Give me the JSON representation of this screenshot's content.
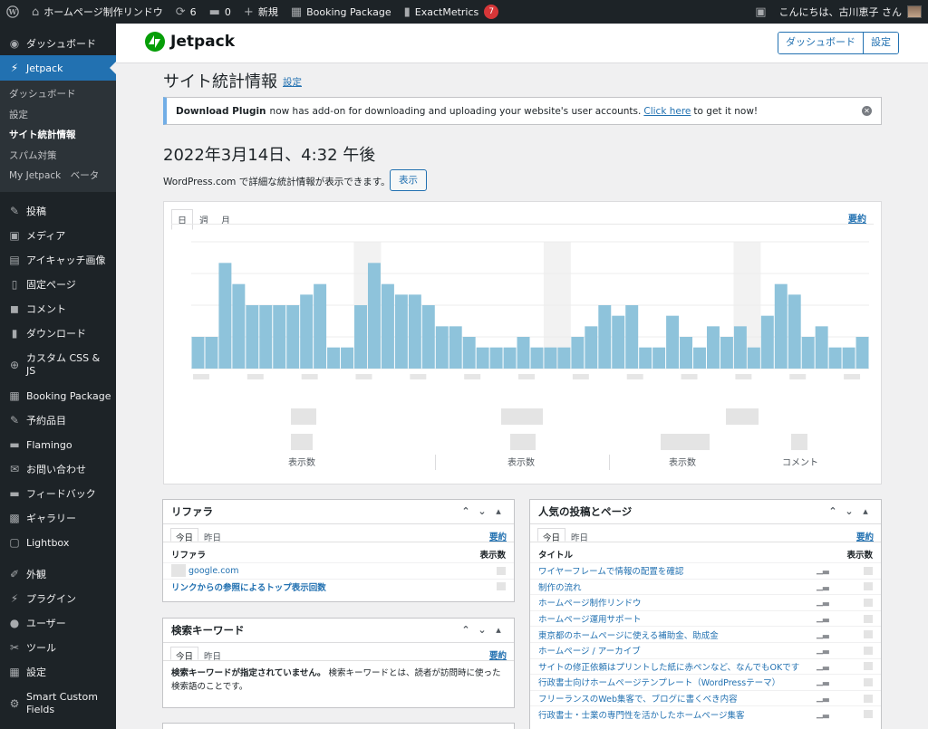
{
  "adminbar": {
    "site_name": "ホームページ制作リンドウ",
    "updates_count": "6",
    "comments_count": "0",
    "new_label": "新規",
    "booking_label": "Booking Package",
    "exactmetrics_label": "ExactMetrics",
    "exactmetrics_badge": "7",
    "greeting": "こんにちは、古川恵子 さん"
  },
  "sidebar": {
    "dashboard": "ダッシュボード",
    "jetpack": "Jetpack",
    "jetpack_sub": [
      "ダッシュボード",
      "設定",
      "サイト統計情報",
      "スパム対策",
      "My Jetpack　ベータ"
    ],
    "items": [
      {
        "label": "投稿",
        "icon": "pin-icon",
        "glyph": "✎"
      },
      {
        "label": "メディア",
        "icon": "media-icon",
        "glyph": "▣"
      },
      {
        "label": "アイキャッチ画像",
        "icon": "image-icon",
        "glyph": "▤"
      },
      {
        "label": "固定ページ",
        "icon": "page-icon",
        "glyph": "▯"
      },
      {
        "label": "コメント",
        "icon": "comment-icon",
        "glyph": "◼"
      },
      {
        "label": "ダウンロード",
        "icon": "download-icon",
        "glyph": "▮"
      }
    ],
    "custom_css": "カスタム CSS & JS",
    "items2": [
      {
        "label": "Booking Package",
        "icon": "calendar-icon",
        "glyph": "▦"
      },
      {
        "label": "予約品目",
        "icon": "pin-icon",
        "glyph": "✎"
      },
      {
        "label": "Flamingo",
        "icon": "flamingo-icon",
        "glyph": "▬"
      },
      {
        "label": "お問い合わせ",
        "icon": "mail-icon",
        "glyph": "✉"
      },
      {
        "label": "フィードバック",
        "icon": "feedback-icon",
        "glyph": "▬"
      },
      {
        "label": "ギャラリー",
        "icon": "gallery-icon",
        "glyph": "▩"
      },
      {
        "label": "Lightbox",
        "icon": "lightbox-icon",
        "glyph": "▢"
      }
    ],
    "items3": [
      {
        "label": "外観",
        "icon": "brush-icon",
        "glyph": "✐"
      },
      {
        "label": "プラグイン",
        "icon": "plugin-icon",
        "glyph": "⚡"
      },
      {
        "label": "ユーザー",
        "icon": "user-icon",
        "glyph": "●"
      },
      {
        "label": "ツール",
        "icon": "wrench-icon",
        "glyph": "✂"
      },
      {
        "label": "設定",
        "icon": "settings-icon",
        "glyph": "▦"
      }
    ],
    "smart_custom_fields": "Smart Custom Fields"
  },
  "jp_header": {
    "brand": "Jetpack",
    "nav_dashboard": "ダッシュボード",
    "nav_settings": "設定"
  },
  "main": {
    "title": "サイト統計情報",
    "title_link": "設定",
    "notice_bold": "Download Plugin",
    "notice_text": "now has add-on for downloading and uploading your website's user accounts.",
    "notice_link": "Click here",
    "notice_tail": "to get it now!",
    "date": "2022年3月14日、4:32 午後",
    "wpcom_text": "WordPress.com で詳細な統計情報が表示できます。",
    "show_button": "表示"
  },
  "chart_panel": {
    "tabs": [
      "日",
      "週",
      "月"
    ],
    "summary": "要約",
    "stat_labels": [
      "表示数",
      "表示数",
      "表示数",
      "コメント"
    ]
  },
  "chart_data": {
    "type": "bar",
    "title": "",
    "xlabel": "",
    "ylabel": "",
    "values": [
      3,
      3,
      10,
      8,
      6,
      6,
      6,
      6,
      7,
      8,
      2,
      2,
      6,
      10,
      8,
      7,
      7,
      6,
      4,
      4,
      3,
      2,
      2,
      2,
      3,
      2,
      2,
      2,
      3,
      4,
      6,
      5,
      6,
      2,
      2,
      5,
      3,
      2,
      4,
      3,
      4,
      2,
      5,
      8,
      7,
      3,
      4,
      2,
      2,
      3
    ],
    "ylim": [
      0,
      12
    ]
  },
  "referrers": {
    "title": "リファラ",
    "tabs": [
      "今日",
      "昨日"
    ],
    "summary": "要約",
    "col1": "リファラ",
    "col2": "表示数",
    "rows": [
      "google.com"
    ],
    "footer_link": "リンクからの参照によるトップ表示回数"
  },
  "search_terms": {
    "title": "検索キーワード",
    "tabs": [
      "今日",
      "昨日"
    ],
    "summary": "要約",
    "empty_bold": "検索キーワードが指定されていません。",
    "empty_text": "検索キーワードとは、読者が訪問時に使った検索語のことです。"
  },
  "popular": {
    "title": "人気の投稿とページ",
    "tabs": [
      "今日",
      "昨日"
    ],
    "summary": "要約",
    "col1": "タイトル",
    "col2": "表示数",
    "rows": [
      "ワイヤーフレームで情報の配置を確認",
      "制作の流れ",
      "ホームページ制作リンドウ",
      "ホームページ運用サポート",
      "東京都のホームページに使える補助金、助成金",
      "ホームページ / アーカイブ",
      "サイトの修正依頼はプリントした紙に赤ペンなど、なんでもOKです",
      "行政書士向けホームページテンプレート（WordPressテーマ）",
      "フリーランスのWeb集客で、ブログに書くべき内容",
      "行政書士・士業の専門性を活かしたホームページ集客"
    ]
  }
}
